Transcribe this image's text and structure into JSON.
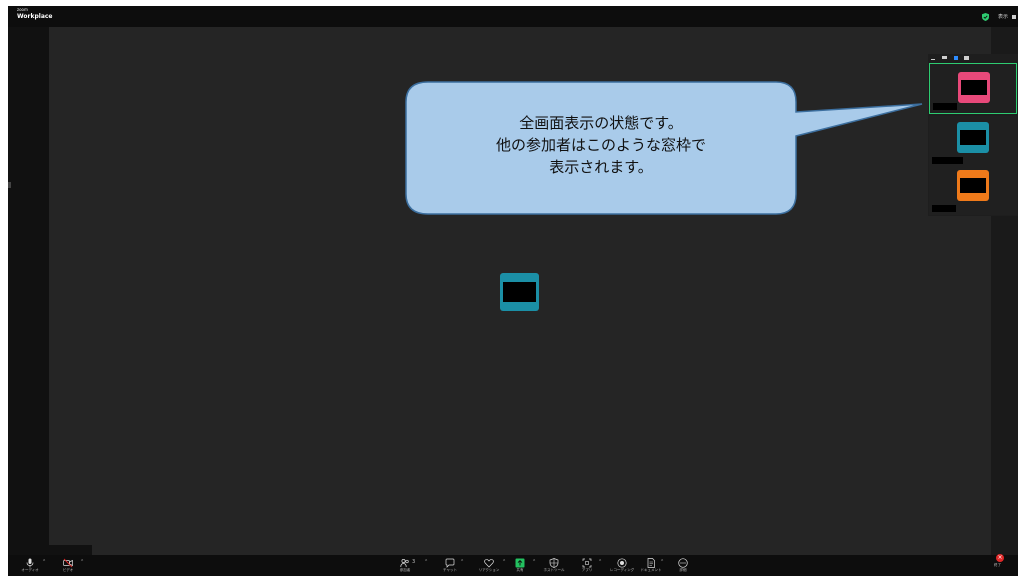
{
  "app": {
    "logo_small": "zoom",
    "logo_big": "Workplace"
  },
  "topbar": {
    "view_label": "表示"
  },
  "callout": {
    "lines": [
      "全画面表示の状態です。",
      "他の参加者はこのような窓枠で",
      "表示されます。"
    ]
  },
  "colors": {
    "accent_pink": "#e8497a",
    "accent_teal": "#1b8fa6",
    "accent_orange": "#ef7a1a",
    "active_green": "#2ecc71",
    "callout_fill": "#a9cbea",
    "callout_stroke": "#3c6f9f",
    "end_red": "#e02828",
    "stage_bg": "#252525"
  },
  "participants_panel": {
    "tiles": [
      {
        "color": "pink",
        "active": true
      },
      {
        "color": "teal",
        "active": false
      },
      {
        "color": "orange",
        "active": false
      }
    ]
  },
  "toolbar": {
    "left": [
      {
        "icon": "microphone-icon",
        "label": "オーディオ"
      },
      {
        "icon": "video-off-icon",
        "label": "ビデオ"
      }
    ],
    "center": [
      {
        "icon": "participants-icon",
        "label": "参加者",
        "count": "3"
      },
      {
        "icon": "chat-icon",
        "label": "チャット"
      },
      {
        "icon": "reactions-icon",
        "label": "リアクション"
      },
      {
        "icon": "share-icon",
        "label": "共有"
      },
      {
        "icon": "host-tools-icon",
        "label": "ホストツール"
      },
      {
        "icon": "apps-icon",
        "label": "アプリ"
      },
      {
        "icon": "record-icon",
        "label": "レコーディング"
      },
      {
        "icon": "document-icon",
        "label": "ドキュメント"
      },
      {
        "icon": "more-icon",
        "label": "詳細"
      }
    ],
    "end_label": "終了"
  }
}
